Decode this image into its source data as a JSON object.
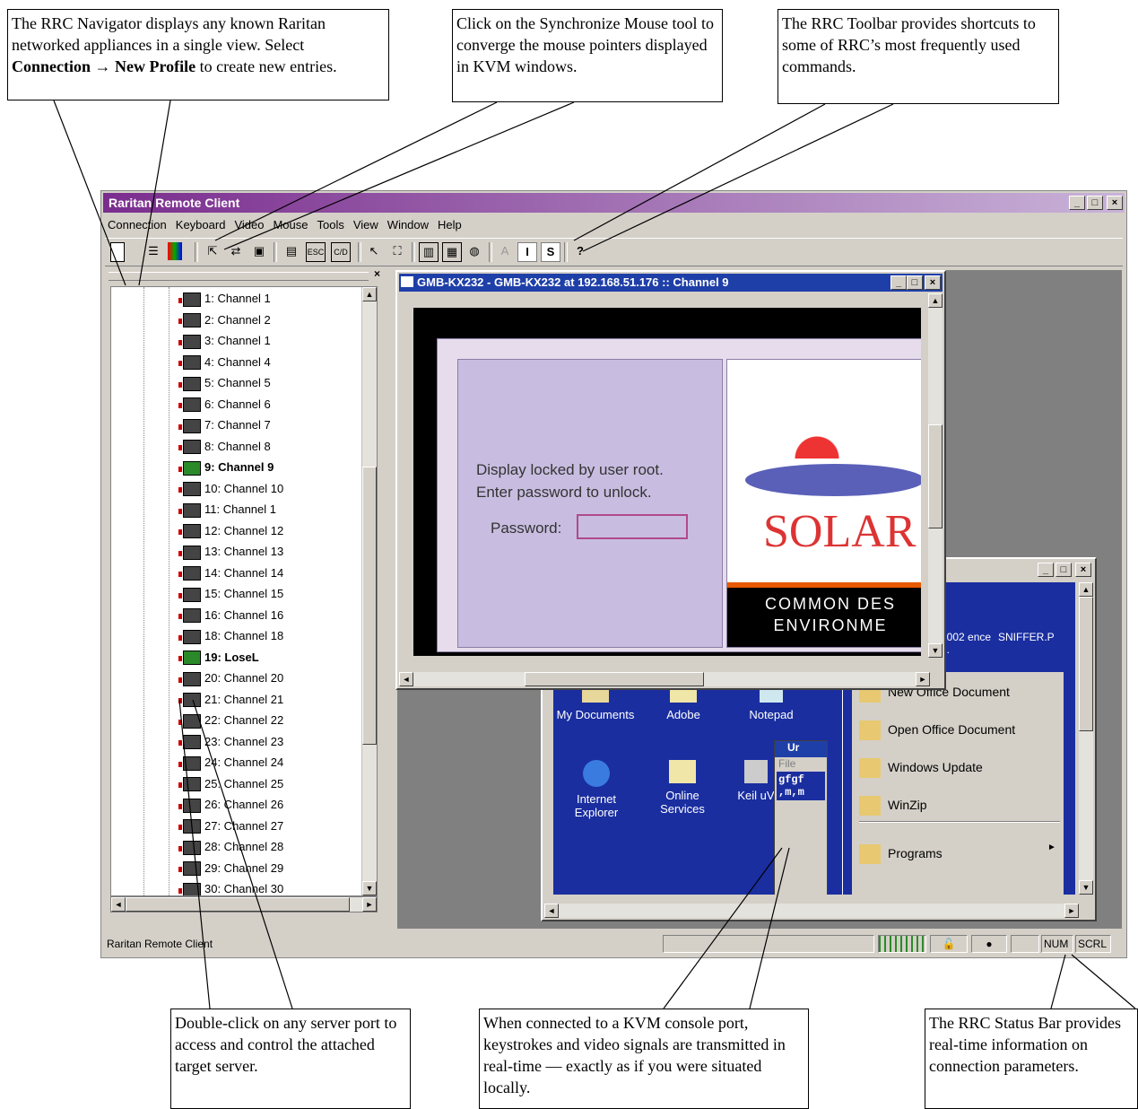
{
  "callouts": {
    "navigator": {
      "text1": "The RRC Navigator displays any known Raritan networked appliances in a single view. Select ",
      "b1": "Connection",
      "arrow": " → ",
      "b2": "New Profile",
      "text2": " to create new entries."
    },
    "sync_mouse": "Click on the Synchronize Mouse tool to converge the mouse pointers displayed in KVM windows.",
    "toolbar": "The RRC Toolbar provides shortcuts to some of RRC’s most frequently used commands.",
    "double_click": "Double-click on any server port to access and control the attached target server.",
    "kvm": "When connected to a KVM console port, keystrokes and video signals are transmitted in real-time — exactly as if you were situated locally.",
    "status_bar": "The RRC Status Bar provides real-time information on connection parameters."
  },
  "app": {
    "title": "Raritan Remote Client",
    "menu": [
      "Connection",
      "Keyboard",
      "Video",
      "Mouse",
      "Tools",
      "View",
      "Window",
      "Help"
    ],
    "status_text": "Raritan Remote Client",
    "status_num": "NUM",
    "status_scrl": "SCRL"
  },
  "navigator": {
    "close_glyph": "×",
    "items": [
      {
        "label": "1: Channel 1",
        "bold": false
      },
      {
        "label": "2: Channel 2",
        "bold": false
      },
      {
        "label": "3: Channel 1",
        "bold": false
      },
      {
        "label": "4: Channel 4",
        "bold": false
      },
      {
        "label": "5: Channel 5",
        "bold": false
      },
      {
        "label": "6: Channel 6",
        "bold": false
      },
      {
        "label": "7: Channel 7",
        "bold": false
      },
      {
        "label": "8: Channel 8",
        "bold": false
      },
      {
        "label": "9: Channel 9",
        "bold": true
      },
      {
        "label": "10: Channel 10",
        "bold": false
      },
      {
        "label": "11: Channel 1",
        "bold": false
      },
      {
        "label": "12: Channel 12",
        "bold": false
      },
      {
        "label": "13: Channel 13",
        "bold": false
      },
      {
        "label": "14: Channel 14",
        "bold": false
      },
      {
        "label": "15: Channel 15",
        "bold": false
      },
      {
        "label": "16: Channel 16",
        "bold": false
      },
      {
        "label": "18: Channel 18",
        "bold": false
      },
      {
        "label": "19: LoseL",
        "bold": true
      },
      {
        "label": "20: Channel 20",
        "bold": false
      },
      {
        "label": "21: Channel 21",
        "bold": false
      },
      {
        "label": "22: Channel 22",
        "bold": false
      },
      {
        "label": "23: Channel 23",
        "bold": false
      },
      {
        "label": "24: Channel 24",
        "bold": false
      },
      {
        "label": "25: Channel 25",
        "bold": false
      },
      {
        "label": "26: Channel 26",
        "bold": false
      },
      {
        "label": "27: Channel 27",
        "bold": false
      },
      {
        "label": "28: Channel 28",
        "bold": false
      },
      {
        "label": "29: Channel 29",
        "bold": false
      },
      {
        "label": "30: Channel 30",
        "bold": false
      }
    ]
  },
  "kvm_window": {
    "title": "GMB-KX232 - GMB-KX232 at 192.168.51.176 :: Channel 9",
    "lock_line1": "Display locked by user root.",
    "lock_line2": "Enter password to unlock.",
    "password_label": "Password:",
    "brand": "SOLAR",
    "cde_line1": "COMMON DES",
    "cde_line2": "ENVIRONME"
  },
  "desktop_window": {
    "icons": [
      "My Documents",
      "Adobe",
      "Notepad",
      "Internet Explorer",
      "Online Services",
      "Keil uV"
    ],
    "file_labels": [
      "2002 ence ...",
      "SNIFFER.P"
    ],
    "start_menu": [
      "New Office Document",
      "Open Office Document",
      "Windows Update",
      "WinZip",
      "Programs"
    ],
    "popup_file": "File",
    "popup_text1": "gfgf",
    "popup_text2": ",m,m",
    "popup_title": "Ur"
  },
  "colors": {
    "kvm_title": "#1f3fa8",
    "lock_panel": "#c8bde0",
    "desktop_bg": "#1a2ea0"
  }
}
